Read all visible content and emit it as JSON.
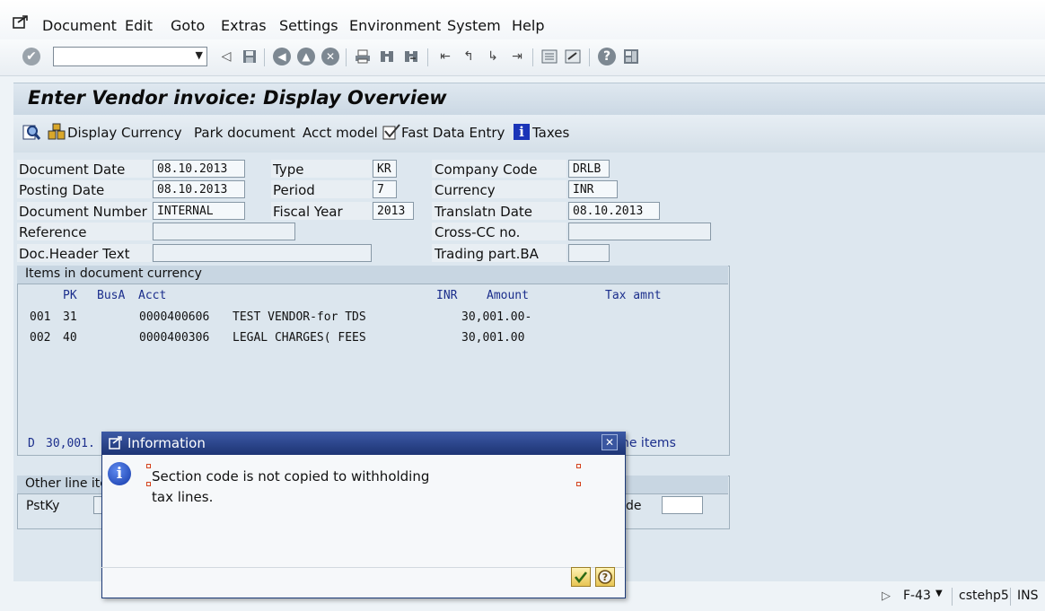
{
  "menu": {
    "items": [
      "Document",
      "Edit",
      "Goto",
      "Extras",
      "Settings",
      "Environment",
      "System",
      "Help"
    ]
  },
  "toolbar": {
    "command_field_value": "",
    "icons": [
      "enter-icon",
      "back-icon",
      "save-icon",
      "back-nav-icon",
      "exit-icon",
      "cancel-icon",
      "print-icon",
      "find-icon",
      "find-next-icon",
      "first-page-icon",
      "prev-page-icon",
      "next-page-icon",
      "last-page-icon",
      "new-session-icon",
      "shortcut-icon",
      "help-icon",
      "layout-icon"
    ]
  },
  "title": "Enter Vendor invoice: Display Overview",
  "app_toolbar": {
    "display_currency": "Display Currency",
    "park_document": "Park document",
    "acct_model": "Acct model",
    "fast_data_entry": "Fast Data Entry",
    "taxes": "Taxes"
  },
  "header": {
    "document_date_label": "Document Date",
    "document_date": "08.10.2013",
    "posting_date_label": "Posting Date",
    "posting_date": "08.10.2013",
    "document_number_label": "Document Number",
    "document_number": "INTERNAL",
    "reference_label": "Reference",
    "reference": "",
    "doc_header_text_label": "Doc.Header Text",
    "doc_header_text": "",
    "type_label": "Type",
    "type": "KR",
    "period_label": "Period",
    "period": "7",
    "fiscal_year_label": "Fiscal Year",
    "fiscal_year": "2013",
    "company_code_label": "Company Code",
    "company_code": "DRLB",
    "currency_label": "Currency",
    "currency": "INR",
    "translatn_date_label": "Translatn Date",
    "translatn_date": "08.10.2013",
    "cross_cc_label": "Cross-CC no.",
    "cross_cc": "",
    "trading_part_label": "Trading part.BA",
    "trading_part": ""
  },
  "items": {
    "title": "Items in document currency",
    "col_pk": "PK",
    "col_busa": "BusA",
    "col_acct": "Acct",
    "col_currency": "INR",
    "col_amount": "Amount",
    "col_tax": "Tax amnt",
    "rows": [
      {
        "no": "001",
        "pk": "31",
        "acct": "0000400606",
        "text": "TEST VENDOR-for TDS",
        "amount": "30,001.00-"
      },
      {
        "no": "002",
        "pk": "40",
        "acct": "0000400306",
        "text": "LEGAL CHARGES( FEES",
        "amount": "30,001.00"
      }
    ],
    "total_prefix": "D",
    "total_value": "30,001.",
    "more_link": "ne items"
  },
  "other_line": {
    "title": "Other line ite",
    "pstky_label": "PstKy",
    "de_label": "de"
  },
  "status": {
    "transaction": "F-43",
    "server": "cstehp5",
    "mode": "INS"
  },
  "dialog": {
    "title": "Information",
    "message": "Section code is not copied to withholding tax lines."
  }
}
